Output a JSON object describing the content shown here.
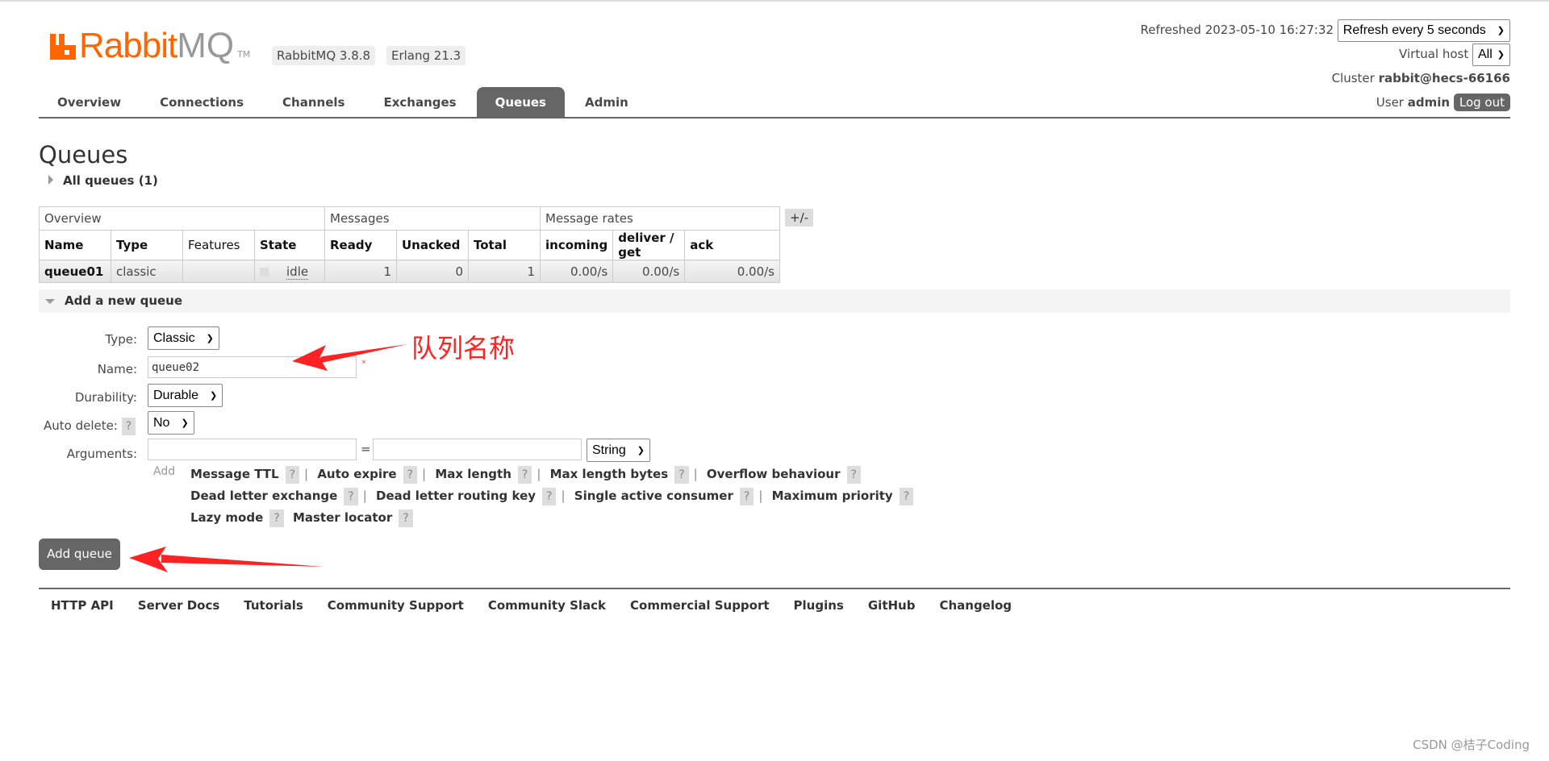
{
  "header": {
    "logo_text": "RabbitMQ",
    "logo_rabbit": "Rabbit",
    "logo_mq": "MQ",
    "logo_tm": "TM",
    "version_badge": "RabbitMQ 3.8.8",
    "erlang_badge": "Erlang 21.3",
    "refreshed": "Refreshed 2023-05-10 16:27:32",
    "refresh_select": "Refresh every 5 seconds",
    "vhost_label": "Virtual host",
    "vhost_select": "All",
    "cluster_label": "Cluster",
    "cluster_name": "rabbit@hecs-66166",
    "user_label": "User",
    "user_name": "admin",
    "logout": "Log out"
  },
  "tabs": [
    {
      "label": "Overview"
    },
    {
      "label": "Connections"
    },
    {
      "label": "Channels"
    },
    {
      "label": "Exchanges"
    },
    {
      "label": "Queues",
      "active": true
    },
    {
      "label": "Admin"
    }
  ],
  "page": {
    "title": "Queues",
    "all_queues": "All queues (1)",
    "plus_minus": "+/-"
  },
  "table": {
    "groups": [
      "Overview",
      "Messages",
      "Message rates"
    ],
    "columns": [
      "Name",
      "Type",
      "Features",
      "State",
      "Ready",
      "Unacked",
      "Total",
      "incoming",
      "deliver / get",
      "ack"
    ],
    "rows": [
      {
        "name": "queue01",
        "type": "classic",
        "features": "",
        "state": "idle",
        "ready": "1",
        "unacked": "0",
        "total": "1",
        "incoming": "0.00/s",
        "deliver_get": "0.00/s",
        "ack": "0.00/s"
      }
    ]
  },
  "form": {
    "section": "Add a new queue",
    "type_label": "Type:",
    "type_value": "Classic",
    "name_label": "Name:",
    "name_value": "queue02",
    "required": "*",
    "durability_label": "Durability:",
    "durability_value": "Durable",
    "autodelete_label": "Auto delete:",
    "autodelete_value": "No",
    "arguments_label": "Arguments:",
    "equals": "=",
    "arg_type": "String",
    "add": "Add",
    "help": "?",
    "arg_links": [
      "Message TTL",
      "Auto expire",
      "Max length",
      "Max length bytes",
      "Overflow behaviour",
      "Dead letter exchange",
      "Dead letter routing key",
      "Single active consumer",
      "Maximum priority",
      "Lazy mode",
      "Master locator"
    ],
    "submit": "Add queue"
  },
  "annotation": {
    "text": "队列名称",
    "color": "#ff2222"
  },
  "footer": [
    "HTTP API",
    "Server Docs",
    "Tutorials",
    "Community Support",
    "Community Slack",
    "Commercial Support",
    "Plugins",
    "GitHub",
    "Changelog"
  ],
  "watermark": "CSDN @桔子Coding",
  "colors": {
    "brand": "#ff6600",
    "active_tab": "#666666"
  }
}
